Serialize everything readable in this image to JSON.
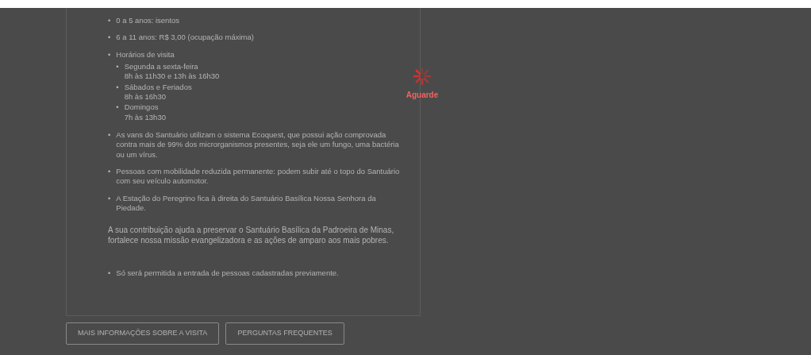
{
  "info_list": [
    {
      "marker": "•",
      "text": "0 a 5 anos: isentos"
    },
    {
      "marker": "•",
      "text": "6 a 11 anos: R$ 3,00 (ocupação máxima)"
    },
    {
      "marker": "•",
      "text": "Horários de visita",
      "children": [
        {
          "marker": "•",
          "text": "Segunda a sexta-feira",
          "detail": "8h às 11h30 e 13h às 16h30"
        },
        {
          "marker": "•",
          "text": "Sábados e Feriados",
          "detail": "8h às 16h30"
        },
        {
          "marker": "•",
          "text": "Domingos",
          "detail": "7h às 13h30"
        }
      ]
    },
    {
      "marker": "•",
      "text": "As vans do Santuário utilizam o sistema Ecoquest, que possui ação comprovada contra mais de 99% dos microrganismos presentes, seja ele um fungo, uma bactéria ou um vírus."
    },
    {
      "marker": "•",
      "text": "Pessoas com mobilidade reduzida permanente: podem subir até o topo do Santuário com seu veículo automotor."
    },
    {
      "marker": "•",
      "text": "A Estação do Peregrino fica à direita do Santuário Basílica Nossa Senhora da Piedade."
    }
  ],
  "contribution": "A sua contribuição ajuda a preservar o Santuário Basílica da Padroeira de Minas, fortalece nossa missão evangelizadora e as ações de amparo aos mais pobres.",
  "entry_notes": [
    {
      "marker": "•",
      "text": "Só será permitida a entrada de pessoas cadastradas previamente."
    }
  ],
  "buttons": [
    "MAIS INFORMAÇÕES SOBRE A VISITA",
    "PERGUNTAS FREQUENTES"
  ],
  "loading": {
    "label": "Aguarde"
  }
}
